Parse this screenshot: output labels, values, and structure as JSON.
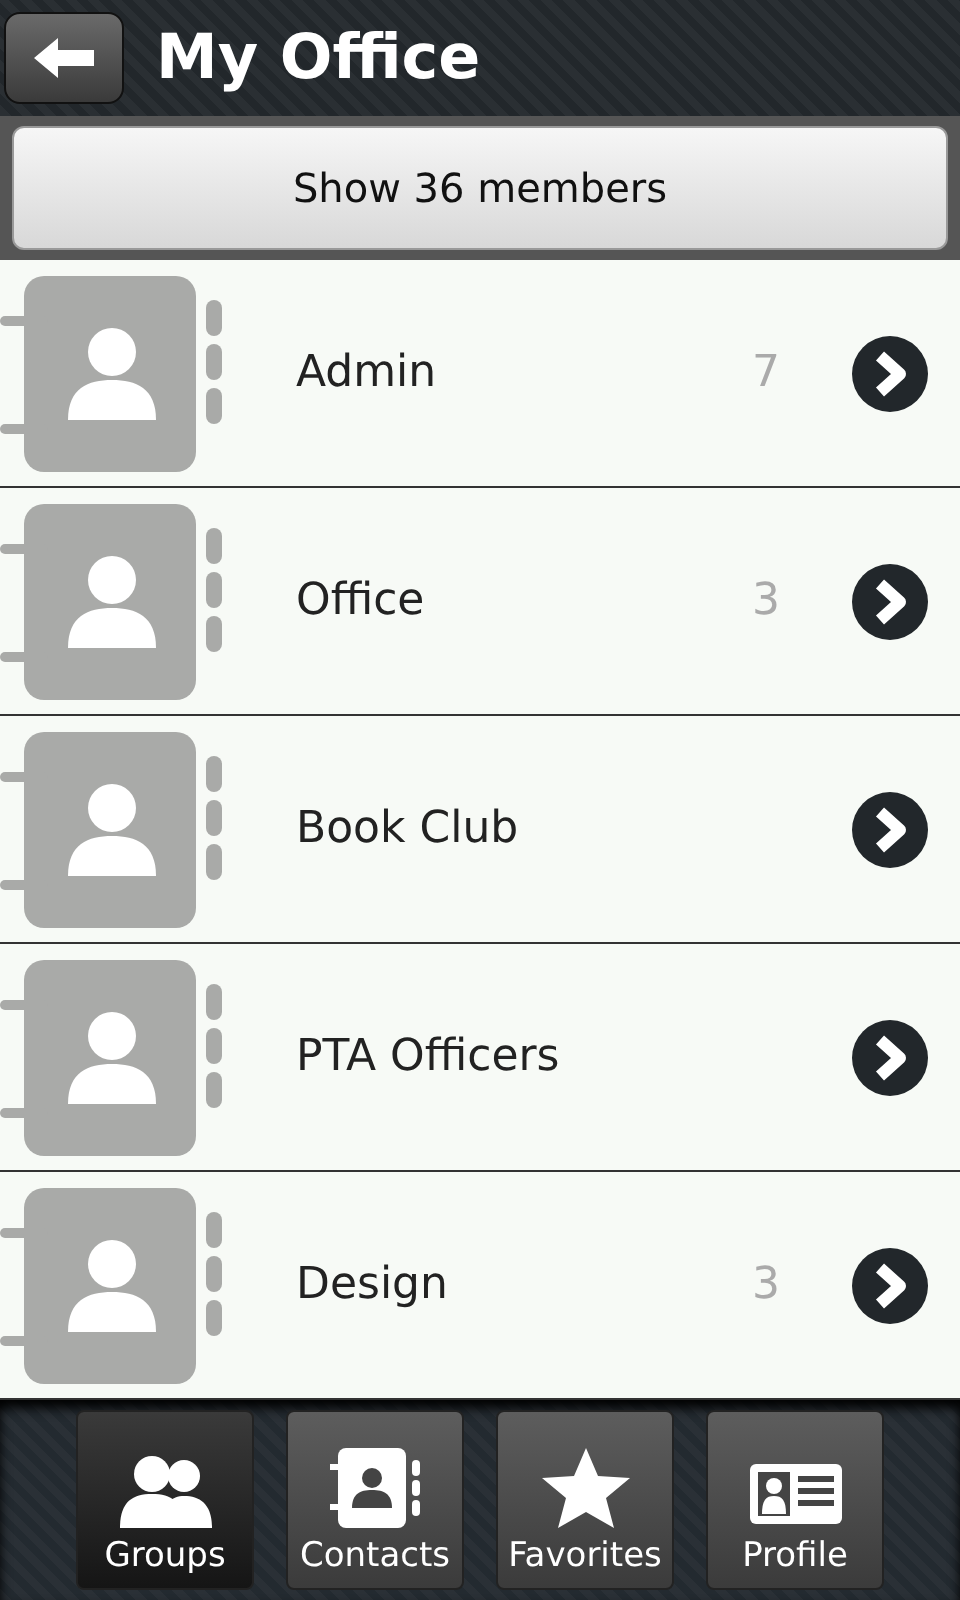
{
  "header": {
    "title": "My Office"
  },
  "show_members_button": "Show 36 members",
  "groups": [
    {
      "name": "Admin",
      "count": "7"
    },
    {
      "name": "Office",
      "count": "3"
    },
    {
      "name": "Book Club"
    },
    {
      "name": "PTA Officers"
    },
    {
      "name": "Design",
      "count": "3"
    }
  ],
  "tabs": [
    {
      "kind": "groups",
      "label": "Groups",
      "selected": true
    },
    {
      "kind": "contacts",
      "label": "Contacts",
      "selected": false
    },
    {
      "kind": "favorites",
      "label": "Favorites",
      "selected": false
    },
    {
      "kind": "profile",
      "label": "Profile",
      "selected": false
    }
  ]
}
